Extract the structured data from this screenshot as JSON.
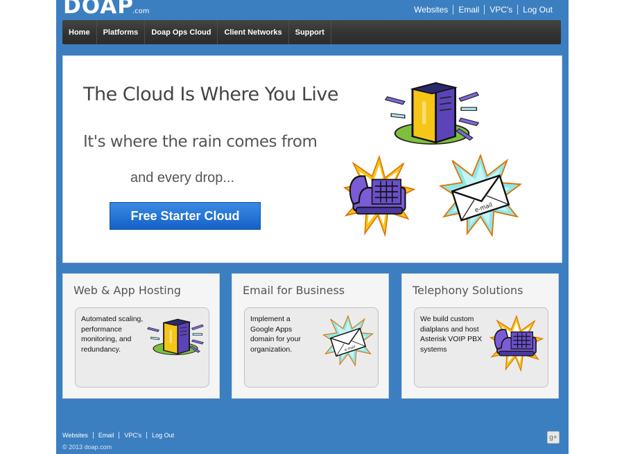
{
  "header": {
    "logo_main": "DOAP",
    "logo_suffix": ".com",
    "top_links": [
      "Websites",
      "Email",
      "VPC's",
      "Log Out"
    ]
  },
  "nav": {
    "items": [
      "Home",
      "Platforms",
      "Doap Ops Cloud",
      "Client Networks",
      "Support"
    ]
  },
  "hero": {
    "headline": "The Cloud Is Where You Live",
    "subhead": "It's where the rain comes from",
    "tagline": "and every drop...",
    "cta_label": "Free Starter Cloud",
    "icons": [
      "server-icon",
      "phone-icon",
      "email-icon"
    ]
  },
  "cards": [
    {
      "title": "Web & App Hosting",
      "body": "Automated scaling, performance monitoring, and redundancy.",
      "icon": "server-icon"
    },
    {
      "title": "Email for Business",
      "body": "Implement a Google Apps domain for your organization.",
      "icon": "email-icon"
    },
    {
      "title": "Telephony Solutions",
      "body": "We build custom dialplans and host Asterisk VOIP PBX systems",
      "icon": "phone-icon"
    }
  ],
  "footer": {
    "links": [
      "Websites",
      "Email",
      "VPC's",
      "Log Out"
    ],
    "copyright": "© 2013 doap.com",
    "social": "g+"
  },
  "colors": {
    "background_blue": "#3b7fc0",
    "nav_dark": "#333333",
    "cta_blue": "#1f6fd6",
    "icon_purple": "#7a5cd6",
    "icon_yellow": "#f5c518"
  }
}
